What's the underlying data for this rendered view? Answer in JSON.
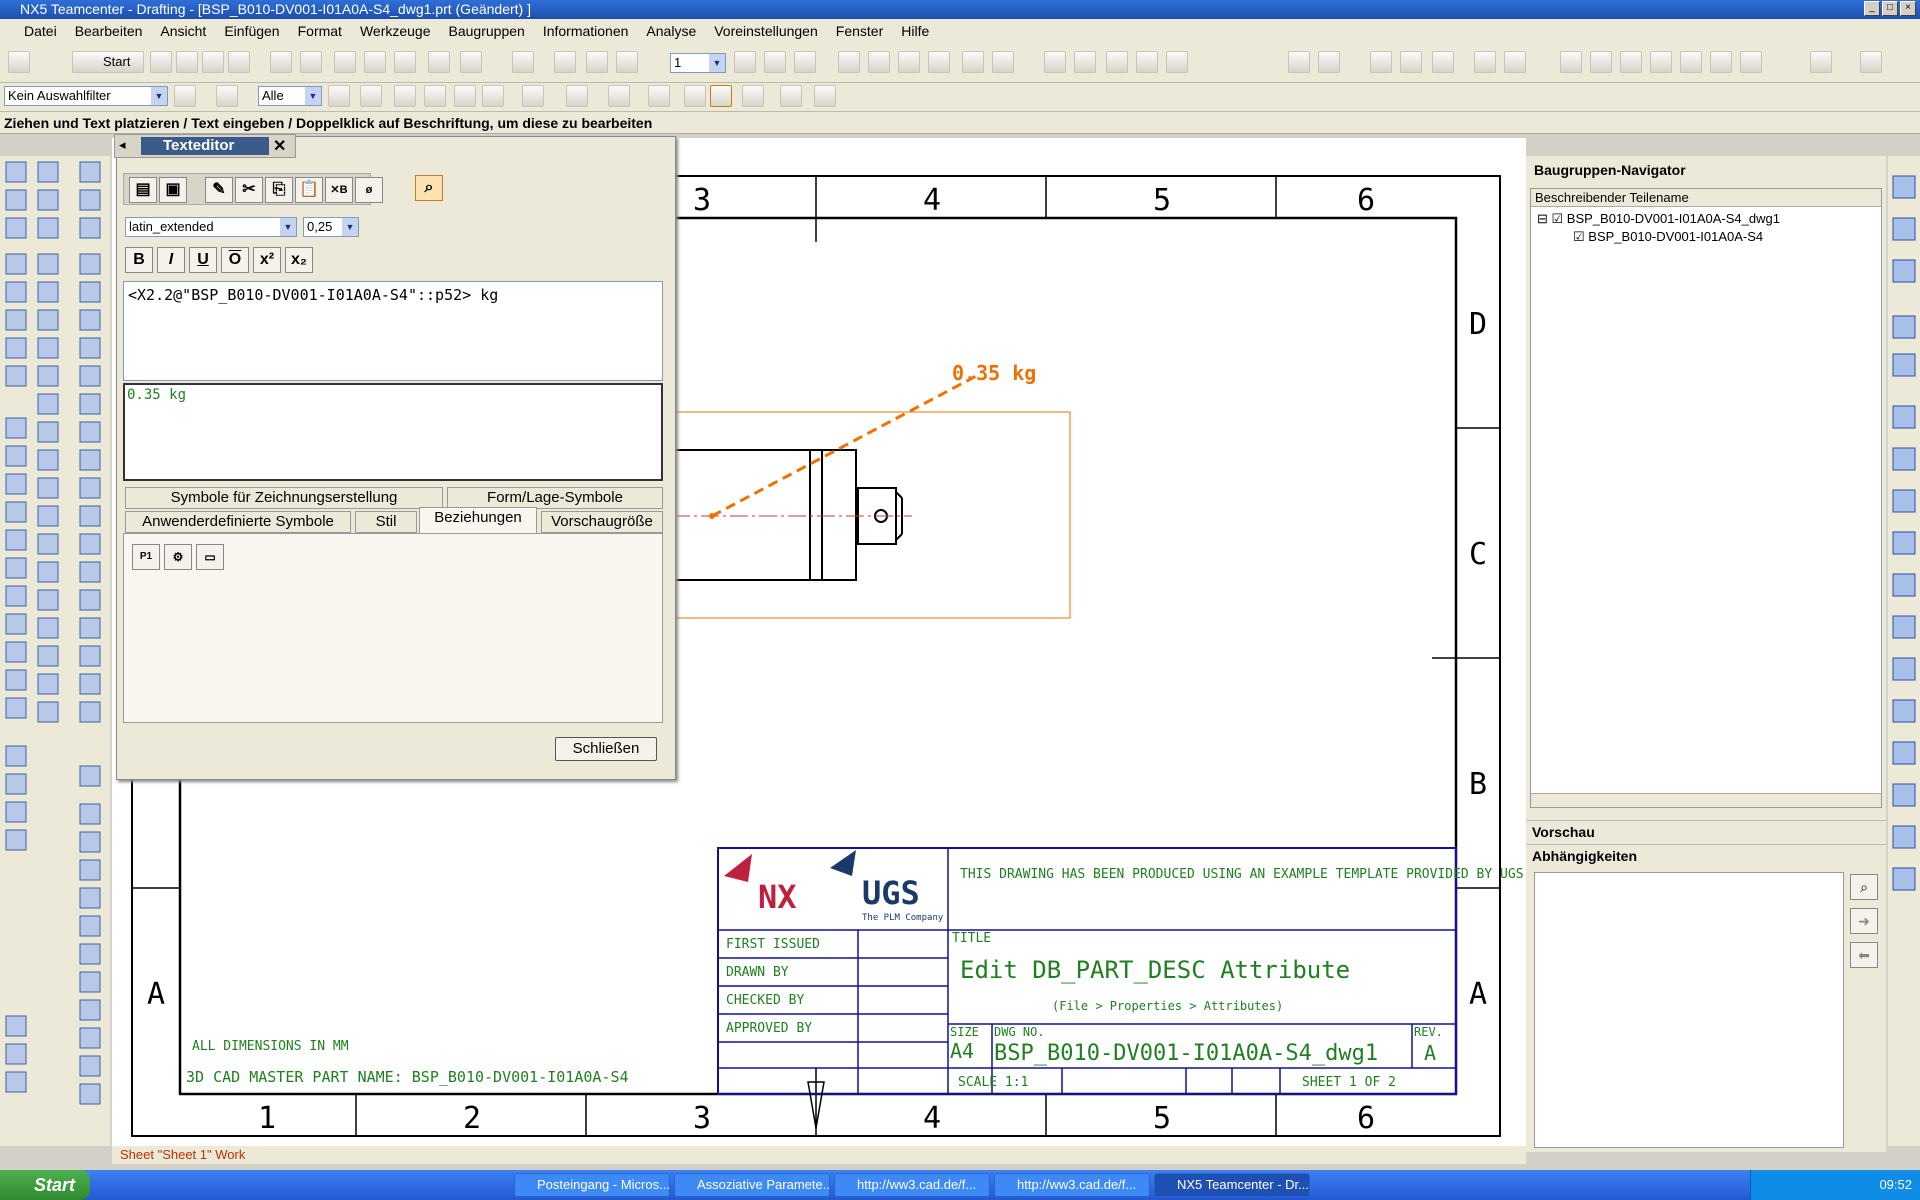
{
  "window": {
    "title": "NX5 Teamcenter - Drafting - [BSP_B010-DV001-I01A0A-S4_dwg1.prt (Geändert) ]"
  },
  "menu": [
    "Datei",
    "Bearbeiten",
    "Ansicht",
    "Einfügen",
    "Format",
    "Werkzeuge",
    "Baugruppen",
    "Informationen",
    "Analyse",
    "Voreinstellungen",
    "Fenster",
    "Hilfe"
  ],
  "toolbar": {
    "start_label": "Start",
    "layer_value": "1",
    "filter_value": "Kein Auswahlfilter",
    "scope_value": "Alle"
  },
  "cue_line": "Ziehen und Text platzieren / Text eingeben / Doppelklick auf Beschriftung, um diese zu bearbeiten",
  "text_editor": {
    "title": "Texteditor",
    "font": "latin_extended",
    "size": "0,25",
    "format_buttons": [
      "B",
      "I",
      "U",
      "O",
      "x²",
      "x₂"
    ],
    "input_text": "<X2.2@\"BSP_B010-DV001-I01A0A-S4\"::p52> kg",
    "preview_text": "0.35 kg",
    "tabs_row1": [
      "Symbole für Zeichnungserstellung",
      "Form/Lage-Symbole"
    ],
    "tabs_row2": [
      "Anwenderdefinierte Symbole",
      "Stil",
      "Beziehungen",
      "Vorschaugröße"
    ],
    "close_label": "Schließen"
  },
  "drawing": {
    "zones_top": [
      "3",
      "4",
      "5",
      "6"
    ],
    "zones_bottom": [
      "1",
      "2",
      "3",
      "4",
      "5",
      "6"
    ],
    "zones_side": [
      "D",
      "C",
      "B",
      "A"
    ],
    "note_label": "0.35 kg",
    "template_note": "THIS DRAWING HAS BEEN PRODUCED USING AN EXAMPLE TEMPLATE PROVIDED BY UGS.",
    "title_label": "TITLE",
    "title_value": "Edit DB_PART_DESC Attribute",
    "title_hint": "(File > Properties > Attributes)",
    "first_issued": "FIRST ISSUED",
    "drawn_by": "DRAWN BY",
    "checked_by": "CHECKED BY",
    "approved_by": "APPROVED BY",
    "size_label": "SIZE",
    "size_value": "A4",
    "dwg_no_label": "DWG NO.",
    "dwg_no_value": "BSP_B010-DV001-I01A0A-S4_dwg1",
    "rev_label": "REV.",
    "rev_value": "A",
    "scale": "SCALE 1:1",
    "sheet": "SHEET 1 OF 2",
    "dims_note": "ALL DIMENSIONS IN MM",
    "master_part": "3D CAD MASTER PART NAME: BSP_B010-DV001-I01A0A-S4",
    "logo_nx": "NX",
    "logo_ugs": "UGS",
    "logo_tagline": "The PLM Company"
  },
  "status": "Sheet \"Sheet 1\" Work",
  "navigator": {
    "title": "Baugruppen-Navigator",
    "column": "Beschreibender Teilename",
    "items": [
      "BSP_B010-DV001-I01A0A-S4_dwg1",
      "BSP_B010-DV001-I01A0A-S4"
    ],
    "preview": "Vorschau",
    "dependencies": "Abhängigkeiten"
  },
  "taskbar": {
    "start": "Start",
    "tasks": [
      "Posteingang - Micros...",
      "Assoziative Paramete...",
      "http://ww3.cad.de/f...",
      "http://ww3.cad.de/f...",
      "NX5 Teamcenter - Dr..."
    ],
    "clock": "09:52"
  },
  "colors": {
    "drawing_line": "#000000",
    "note": "#f07000",
    "title_block": "#1010a0",
    "green_text": "#208020"
  }
}
